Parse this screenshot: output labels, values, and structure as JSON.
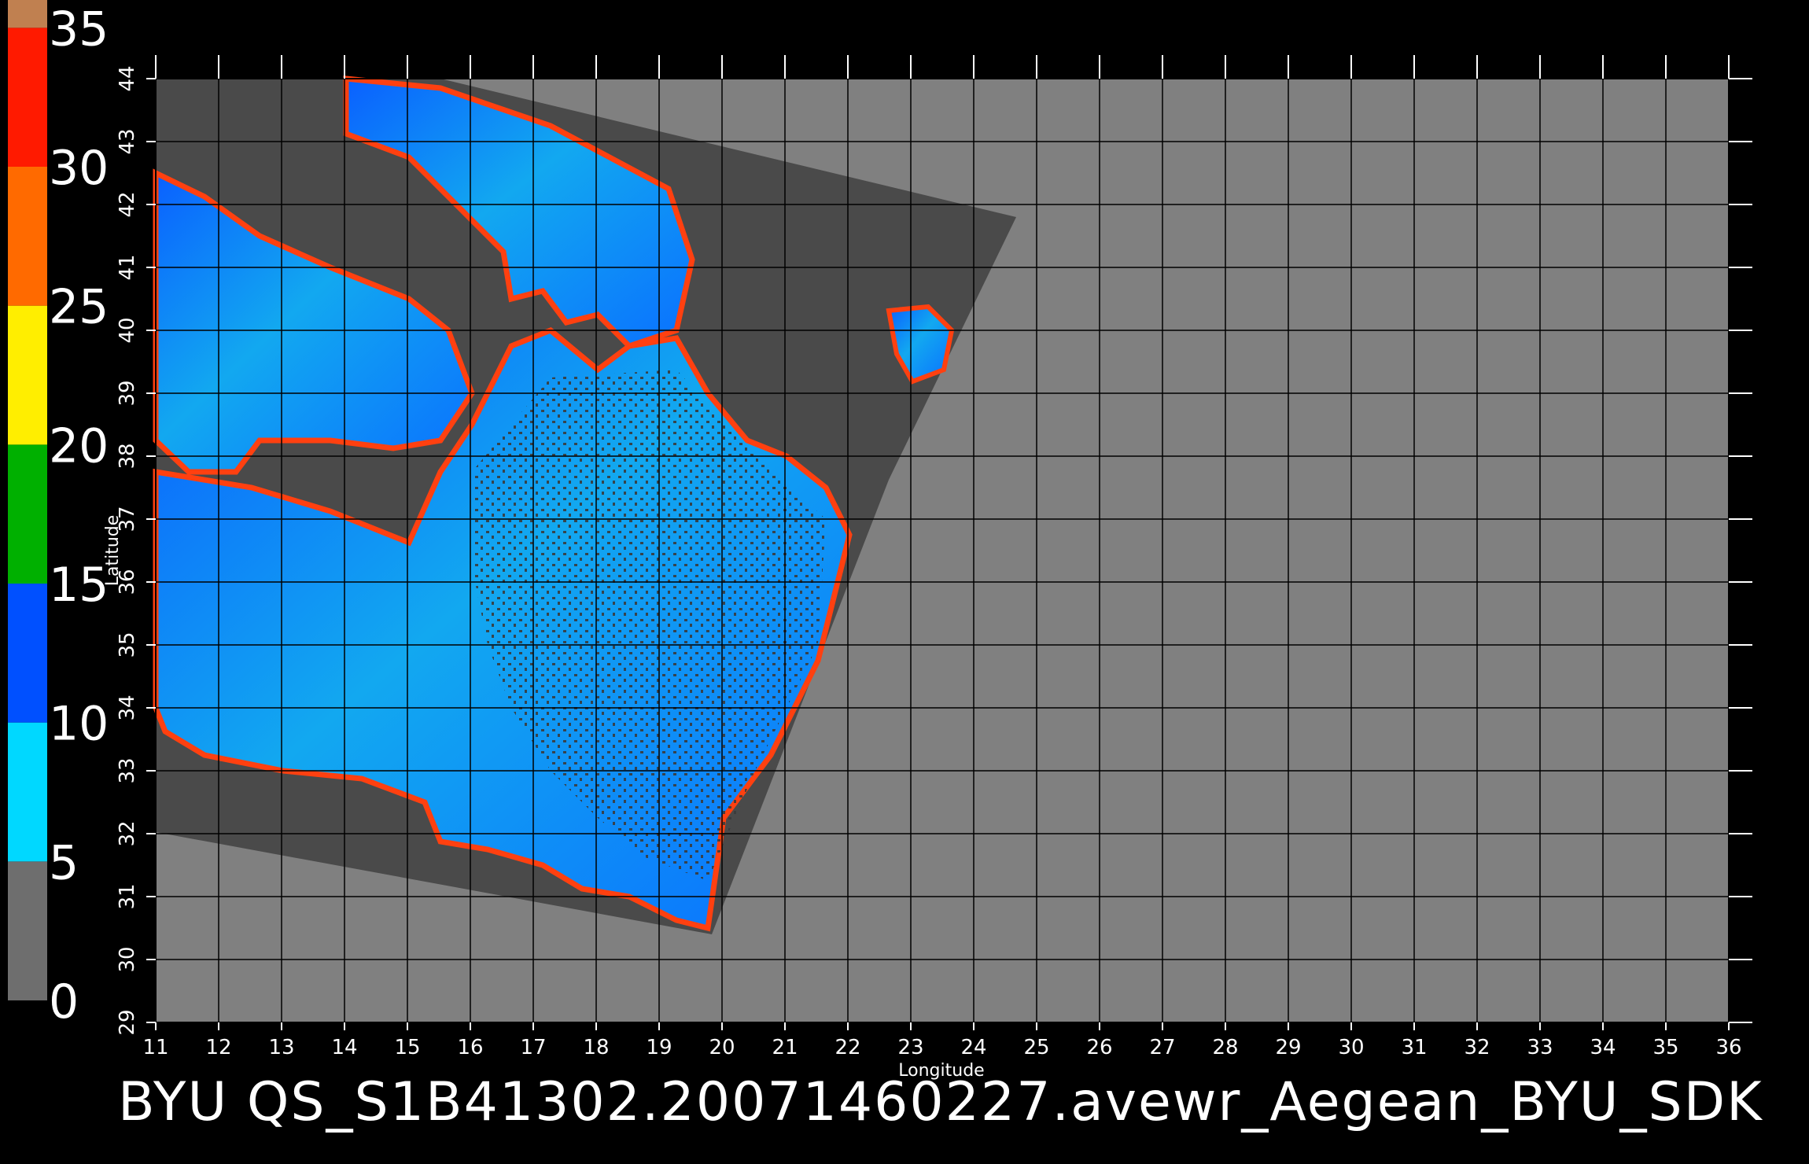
{
  "caption": "BYU QS_S1B41302.20071460227.avewr_Aegean_BYU_SDK",
  "map": {
    "lon_range": [
      11,
      36
    ],
    "lat_range": [
      29,
      44
    ],
    "lon_ticks": [
      "11",
      "12",
      "13",
      "14",
      "15",
      "16",
      "17",
      "18",
      "19",
      "20",
      "21",
      "22",
      "23",
      "24",
      "25",
      "26",
      "27",
      "28",
      "29",
      "30",
      "31",
      "32",
      "33",
      "34",
      "35",
      "36"
    ],
    "lat_ticks": [
      "29",
      "30",
      "31",
      "32",
      "33",
      "34",
      "35",
      "36",
      "37",
      "38",
      "39",
      "40",
      "41",
      "42",
      "43",
      "44"
    ],
    "xlabel": "Longitude",
    "ylabel": "Latitude",
    "grid": true,
    "background_color": "#808080",
    "swath_color": "#4a4a4a"
  },
  "colorbar": {
    "ticks": [
      "0",
      "5",
      "10",
      "15",
      "20",
      "25",
      "30",
      "35"
    ],
    "segments": [
      {
        "from": 0,
        "to": 5,
        "color": "#6e6e6e"
      },
      {
        "from": 5,
        "to": 10,
        "color": "#00d8ff"
      },
      {
        "from": 10,
        "to": 15,
        "color": "#0050ff"
      },
      {
        "from": 15,
        "to": 20,
        "color": "#00b000"
      },
      {
        "from": 20,
        "to": 25,
        "color": "#ffee00"
      },
      {
        "from": 25,
        "to": 30,
        "color": "#ff6a00"
      },
      {
        "from": 30,
        "to": 35,
        "color": "#ff1a00"
      },
      {
        "from": 35,
        "to": 36,
        "color": "#c08050"
      }
    ]
  },
  "colors": {
    "water_light": "#00c8f0",
    "water_mid": "#0a78e6",
    "water_deep": "#0040ff",
    "coast_rim": "#ff2000"
  }
}
